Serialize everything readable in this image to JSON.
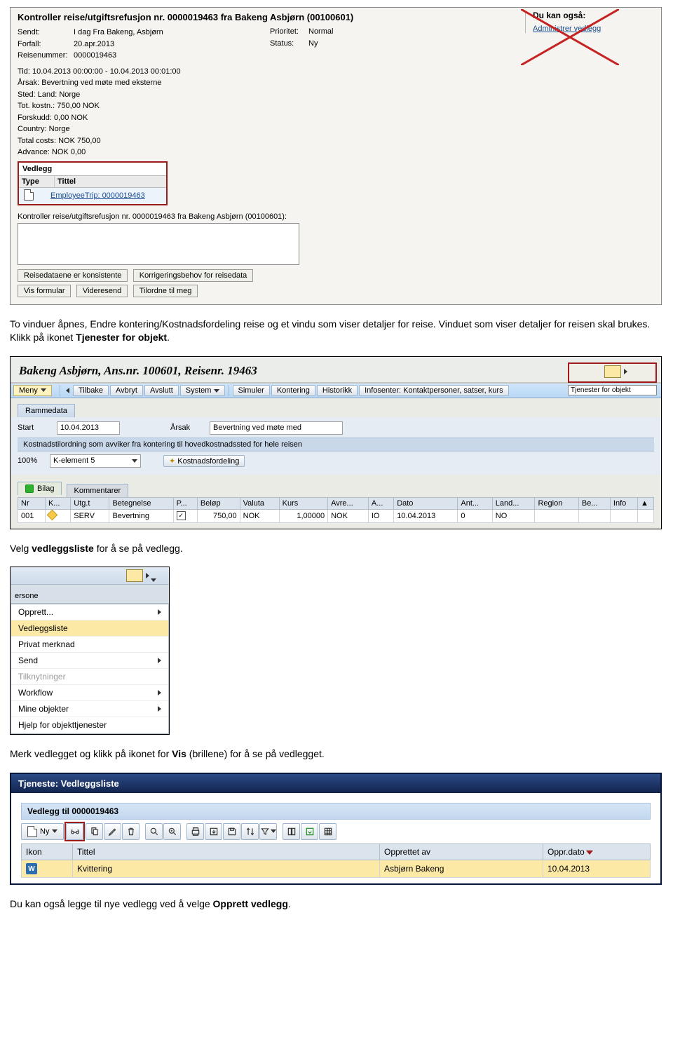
{
  "panel1": {
    "title": "Kontroller reise/utgiftsrefusjon nr. 0000019463 fra Bakeng Asbjørn (00100601)",
    "sent_k": "Sendt:",
    "sent_v": "I dag Fra Bakeng, Asbjørn",
    "due_k": "Forfall:",
    "due_v": "20.apr.2013",
    "tripno_k": "Reisenummer:",
    "tripno_v": "0000019463",
    "prio_k": "Prioritet:",
    "prio_v": "Normal",
    "status_k": "Status:",
    "status_v": "Ny",
    "lines": [
      "Tid: 10.04.2013 00:00:00 - 10.04.2013 00:01:00",
      "Årsak: Bevertning ved møte med eksterne",
      "Sted: Land: Norge",
      "Tot. kostn.: 750,00 NOK",
      "Forskudd: 0,00 NOK",
      "Country: Norge",
      "Total costs: NOK 750,00",
      "Advance: NOK 0,00"
    ],
    "ved_head": "Vedlegg",
    "ved_type": "Type",
    "ved_tittel": "Tittel",
    "ved_link": "EmployeeTrip: 0000019463",
    "kontroll_repeat": "Kontroller reise/utgiftsrefusjon nr. 0000019463 fra Bakeng Asbjørn (00100601):",
    "btn1": "Reisedataene er konsistente",
    "btn2": "Korrigeringsbehov for reisedata",
    "btn3": "Vis formular",
    "btn4": "Videresend",
    "btn5": "Tilordne til meg",
    "side_title": "Du kan også:",
    "side_link": "Administrer vedlegg"
  },
  "para1_a": "To vinduer åpnes, Endre kontering/Kostnadsfordeling reise og et vindu som viser detaljer for reise. Vinduet som viser detaljer for reisen skal brukes. Klikk på ikonet ",
  "para1_b": "Tjenester for objekt",
  "para1_c": ".",
  "sap": {
    "title": "Bakeng Asbjørn, Ans.nr. 100601, Reisenr. 19463",
    "tjenester": "Tjenester for objekt",
    "menu": "Meny",
    "tb": [
      "Tilbake",
      "Avbryt",
      "Avslutt",
      "System",
      "Simuler",
      "Kontering",
      "Historikk",
      "Infosenter: Kontaktpersoner, satser, kurs"
    ],
    "rammedata": "Rammedata",
    "start_lbl": "Start",
    "start_v": "10.04.2013",
    "arsak_lbl": "Årsak",
    "arsak_v": "Bevertning ved møte med",
    "band": "Kostnadstilordning som avviker fra kontering til hovedkostnadssted for hele reisen",
    "hundre": "100%",
    "ke5": "K-element 5",
    "kostfor": "Kostnadsfordeling",
    "tab_bilag": "Bilag",
    "tab_komm": "Kommentarer",
    "cols": [
      "Nr",
      "K...",
      "Utg.t",
      "Betegnelse",
      "P...",
      "Beløp",
      "Valuta",
      "Kurs",
      "Avre...",
      "A...",
      "Dato",
      "Ant...",
      "Land...",
      "Region",
      "Be...",
      "Info"
    ],
    "row": [
      "001",
      "",
      "SERV",
      "Bevertning",
      "",
      "750,00",
      "NOK",
      "1,00000",
      "NOK",
      "IO",
      "10.04.2013",
      "0",
      "NO",
      "",
      "",
      ""
    ]
  },
  "para2_a": "Velg ",
  "para2_b": "vedleggsliste",
  "para2_c": " for å se på vedlegg.",
  "menu": {
    "sideword": "ersone",
    "items": [
      {
        "t": "Opprett...",
        "arr": true
      },
      {
        "t": "Vedleggsliste",
        "sel": true
      },
      {
        "t": "Privat merknad"
      },
      {
        "t": "Send",
        "arr": true
      },
      {
        "t": "Tilknytninger",
        "disabled": true
      },
      {
        "t": "Workflow",
        "arr": true
      },
      {
        "t": "Mine objekter",
        "arr": true
      },
      {
        "t": "Hjelp for objekttjenester"
      }
    ]
  },
  "para3_a": "Merk vedlegget og klikk på ikonet for ",
  "para3_b": "Vis",
  "para3_c": " (brillene) for å se på vedlegget.",
  "svc": {
    "title": "Tjeneste: Vedleggsliste",
    "section": "Vedlegg til 0000019463",
    "ny": "Ny",
    "cols": [
      "Ikon",
      "Tittel",
      "Opprettet av",
      "Oppr.dato"
    ],
    "row": [
      "Kvittering",
      "Asbjørn Bakeng",
      "10.04.2013"
    ]
  },
  "para4_a": "Du kan også legge til nye vedlegg ved å velge ",
  "para4_b": "Opprett vedlegg",
  "para4_c": "."
}
